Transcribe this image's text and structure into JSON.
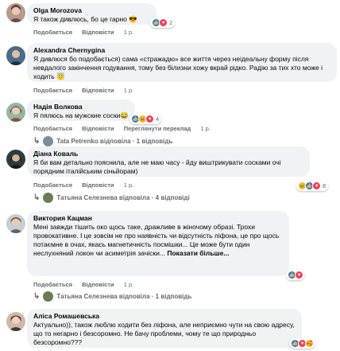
{
  "comments": [
    {
      "author": "Olga Morozova",
      "text": "Я також дивлюсь, бо це гарно 😎",
      "actions": [
        "Подобається",
        "Відповісти",
        "1 р."
      ],
      "reactions": [
        "like",
        "love"
      ],
      "count": "2"
    },
    {
      "author": "Alexandra Chernygina",
      "text": "Я дивлюся бо подобається) сама «стражадю» все життя через неідеальну форму після невдалого закінчення годування, тому без білизни хожу вкрай рідко. Радію за тих хто може і ходить 😇",
      "actions": [
        "Подобається",
        "Відповісти",
        "1 р."
      ],
      "reactions": [],
      "count": ""
    },
    {
      "author": "Надія Волкова",
      "text": "Я пялюсь на мужские соски😂",
      "actions": [
        "Подобається",
        "Відповісти",
        "Переглянути переклад",
        "1 р."
      ],
      "reactions": [
        "like",
        "haha",
        "love"
      ],
      "count": "4"
    },
    {
      "author": "Діана Коваль",
      "text": "Я би вам детально пояснила, але не маю часу - йду виштрикувати сосками очі порядним італійським сіньйорам)",
      "actions": [
        "Подобається",
        "Відповісти",
        "1 р."
      ],
      "reactions": [
        "haha",
        "like",
        "love"
      ],
      "count": "8"
    },
    {
      "author": "Виктория Кацман",
      "text": "Мені завжди тішить око щось таке, дражливе в жіночому образі. Трохи провокативне. І це зовсім не про наявність чи відсутність ліфона, це про щось потаємне в очах, якась магнетичність посмішки... Це може бути один неслухняний локон чи асиметрія зачіски...",
      "more": "Показати більше...",
      "actions": [
        "Подобається",
        "Відповісти",
        "1 р."
      ],
      "reactions": [
        "like",
        "love"
      ],
      "count": ""
    },
    {
      "author": "Аліса Ромашевська",
      "text": "Актуально)), також люблю ходити без ліфона, але неприємно чути на свою адресу, що то негарно і безсоромно. Не бачу проблеми, чому те що природньо безсоромно???",
      "actions": [],
      "reactions": [
        "like",
        "love",
        "care"
      ],
      "count": ""
    }
  ],
  "replies": [
    {
      "text": "Tata Petrenko відповіла · 1 відповідь"
    },
    {
      "text": "Татьяна Селезнева відповіла · 4 відповіді"
    },
    {
      "text": "Татьяна Селезнева відповіла · 1 відповідь"
    }
  ]
}
